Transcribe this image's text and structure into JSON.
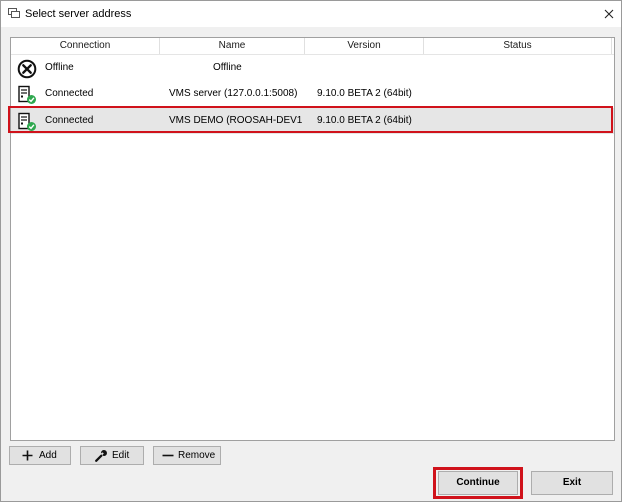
{
  "window": {
    "title": "Select server address"
  },
  "table": {
    "columns": [
      "Connection",
      "Name",
      "Version",
      "Status"
    ],
    "rows": [
      {
        "connection": "Offline",
        "name": "Offline",
        "version": "",
        "status": "",
        "icon": "offline-x-icon"
      },
      {
        "connection": "Connected",
        "name": "VMS server (127.0.0.1:5008)",
        "version": "9.10.0 BETA 2 (64bit)",
        "status": "",
        "icon": "server-connected-icon"
      },
      {
        "connection": "Connected",
        "name": "VMS DEMO (ROOSAH-DEV1",
        "version": "9.10.0 BETA 2 (64bit)",
        "status": "",
        "icon": "server-connected-icon",
        "selected": true
      }
    ]
  },
  "buttons": {
    "add": "Add",
    "edit": "Edit",
    "remove": "Remove",
    "continue": "Continue",
    "exit": "Exit"
  },
  "colors": {
    "highlight": "#d0121b",
    "check_green": "#2fa84f"
  }
}
